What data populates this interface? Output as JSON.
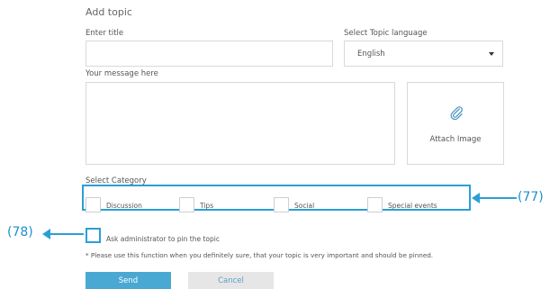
{
  "form": {
    "heading": "Add topic",
    "title_label": "Enter title",
    "title_value": "",
    "language_label": "Select Topic language",
    "language_value": "English",
    "message_label": "Your message here",
    "message_value": "",
    "attach_label": "Attach Image",
    "attach_icon": "paperclip-icon",
    "category_label": "Select Category",
    "categories": [
      "Discussion",
      "Tips",
      "Social",
      "Special events"
    ],
    "pin_label": "Ask administrator to pin the topic",
    "note": "* Please use this function when you definitely sure, that your topic is very important and should be pinned.",
    "send_label": "Send",
    "cancel_label": "Cancel"
  },
  "annotations": {
    "category_callout": "(77)",
    "pin_callout": "(78)"
  },
  "colors": {
    "accent": "#2a9fd6",
    "send_button": "#4aa9d3",
    "cancel_button": "#e6e6e6"
  }
}
